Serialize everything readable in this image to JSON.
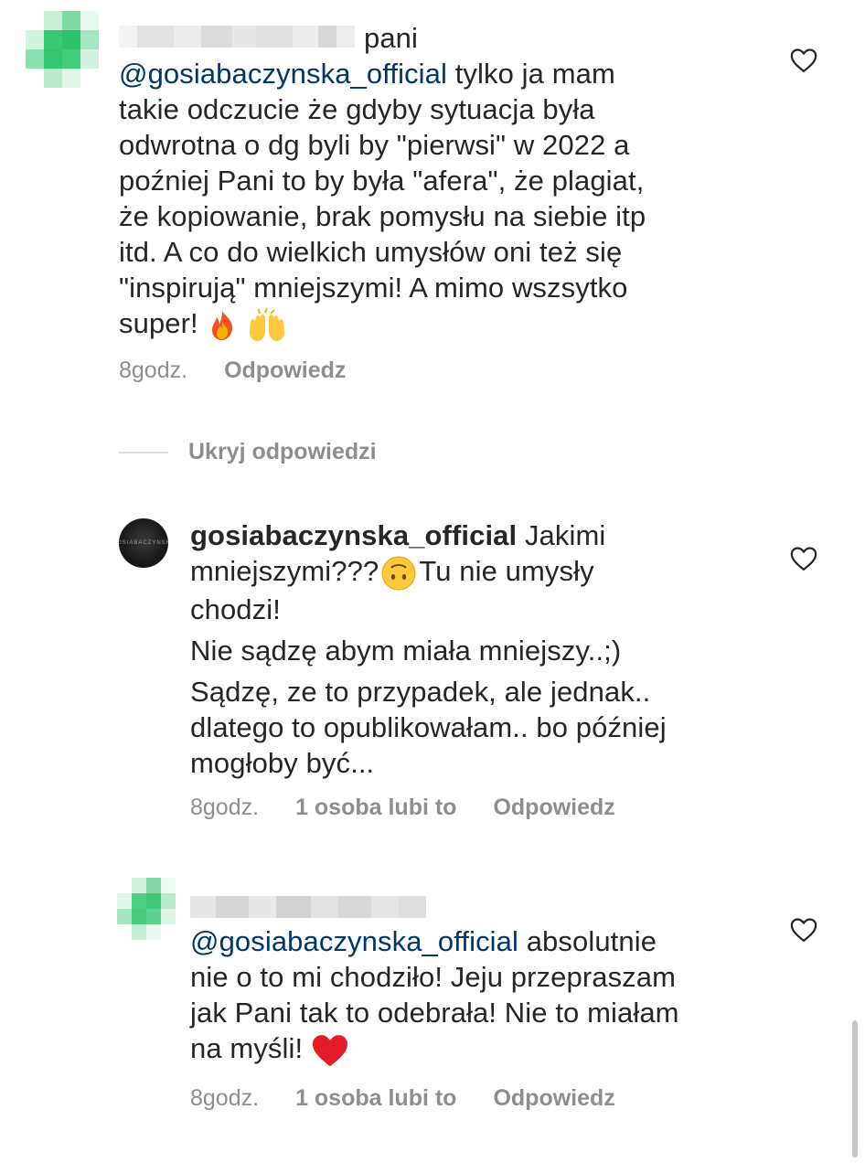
{
  "comment1": {
    "username_suffix": "pani",
    "mention": "@gosiabaczynska_official",
    "lines": [
      " tylko ja mam",
      "takie odczucie że gdyby sytuacja była",
      "odwrotna o dg byli by \"pierwsi\" w 2022 a",
      "poźniej Pani to by była \"afera\", że plagiat,",
      "że kopiowanie, brak pomysłu na siebie itp",
      "itd. A co do wielkich umysłów oni też się",
      "\"inspirują\" mniejszymi! A mimo wszsytko",
      "super! "
    ],
    "emoji": [
      "fire-emoji",
      "raising-hands-emoji"
    ],
    "time": "8godz.",
    "reply": "Odpowiedz"
  },
  "hide_replies": "Ukryj odpowiedzi",
  "reply1": {
    "username": "gosiabaczynska_official",
    "line1_rest": " Jakimi",
    "line2_a": "mniejszymi???",
    "line2_b": "Tu nie umysły",
    "line3": "chodzi!",
    "line4": "Nie sądzę abym miała mniejszy..;)",
    "line5": "Sądzę, ze to przypadek, ale jednak..",
    "line6": "dlatego to opublikowałam.. bo później",
    "line7": "mogłoby być...",
    "emoji": "upside-down-face-emoji",
    "time": "8godz.",
    "likes": "1 osoba lubi to",
    "reply": "Odpowiedz"
  },
  "reply2": {
    "mention": "@gosiabaczynska_official",
    "line1_rest": " absolutnie",
    "line2": "nie o to mi chodziło! Jeju przepraszam",
    "line3": "jak Pani tak to odebrała! Nie to miałam",
    "line4": "na myśli! ",
    "emoji": "red-heart-emoji",
    "time": "8godz.",
    "likes": "1 osoba lubi to",
    "reply": "Odpowiedz"
  },
  "icons": {
    "like": "heart-outline-icon"
  },
  "colors": {
    "mention": "#00376b",
    "meta": "#8e8e8e",
    "text": "#262626"
  }
}
